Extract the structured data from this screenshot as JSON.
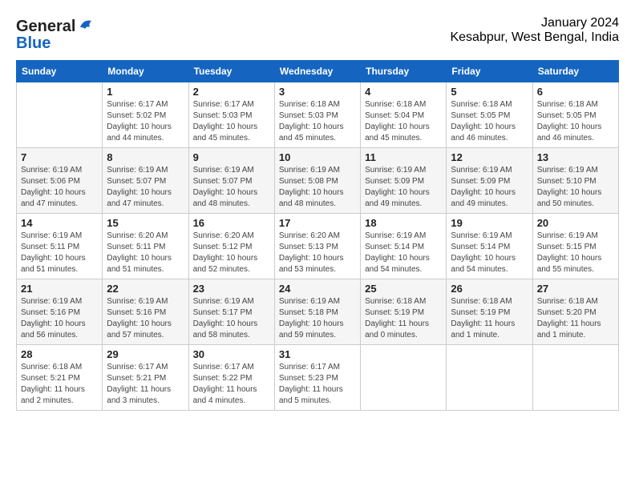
{
  "logo": {
    "general": "General",
    "blue": "Blue"
  },
  "header": {
    "month_year": "January 2024",
    "location": "Kesabpur, West Bengal, India"
  },
  "days_of_week": [
    "Sunday",
    "Monday",
    "Tuesday",
    "Wednesday",
    "Thursday",
    "Friday",
    "Saturday"
  ],
  "weeks": [
    [
      {
        "day": "",
        "info": ""
      },
      {
        "day": "1",
        "info": "Sunrise: 6:17 AM\nSunset: 5:02 PM\nDaylight: 10 hours\nand 44 minutes."
      },
      {
        "day": "2",
        "info": "Sunrise: 6:17 AM\nSunset: 5:03 PM\nDaylight: 10 hours\nand 45 minutes."
      },
      {
        "day": "3",
        "info": "Sunrise: 6:18 AM\nSunset: 5:03 PM\nDaylight: 10 hours\nand 45 minutes."
      },
      {
        "day": "4",
        "info": "Sunrise: 6:18 AM\nSunset: 5:04 PM\nDaylight: 10 hours\nand 45 minutes."
      },
      {
        "day": "5",
        "info": "Sunrise: 6:18 AM\nSunset: 5:05 PM\nDaylight: 10 hours\nand 46 minutes."
      },
      {
        "day": "6",
        "info": "Sunrise: 6:18 AM\nSunset: 5:05 PM\nDaylight: 10 hours\nand 46 minutes."
      }
    ],
    [
      {
        "day": "7",
        "info": "Sunrise: 6:19 AM\nSunset: 5:06 PM\nDaylight: 10 hours\nand 47 minutes."
      },
      {
        "day": "8",
        "info": "Sunrise: 6:19 AM\nSunset: 5:07 PM\nDaylight: 10 hours\nand 47 minutes."
      },
      {
        "day": "9",
        "info": "Sunrise: 6:19 AM\nSunset: 5:07 PM\nDaylight: 10 hours\nand 48 minutes."
      },
      {
        "day": "10",
        "info": "Sunrise: 6:19 AM\nSunset: 5:08 PM\nDaylight: 10 hours\nand 48 minutes."
      },
      {
        "day": "11",
        "info": "Sunrise: 6:19 AM\nSunset: 5:09 PM\nDaylight: 10 hours\nand 49 minutes."
      },
      {
        "day": "12",
        "info": "Sunrise: 6:19 AM\nSunset: 5:09 PM\nDaylight: 10 hours\nand 49 minutes."
      },
      {
        "day": "13",
        "info": "Sunrise: 6:19 AM\nSunset: 5:10 PM\nDaylight: 10 hours\nand 50 minutes."
      }
    ],
    [
      {
        "day": "14",
        "info": "Sunrise: 6:19 AM\nSunset: 5:11 PM\nDaylight: 10 hours\nand 51 minutes."
      },
      {
        "day": "15",
        "info": "Sunrise: 6:20 AM\nSunset: 5:11 PM\nDaylight: 10 hours\nand 51 minutes."
      },
      {
        "day": "16",
        "info": "Sunrise: 6:20 AM\nSunset: 5:12 PM\nDaylight: 10 hours\nand 52 minutes."
      },
      {
        "day": "17",
        "info": "Sunrise: 6:20 AM\nSunset: 5:13 PM\nDaylight: 10 hours\nand 53 minutes."
      },
      {
        "day": "18",
        "info": "Sunrise: 6:19 AM\nSunset: 5:14 PM\nDaylight: 10 hours\nand 54 minutes."
      },
      {
        "day": "19",
        "info": "Sunrise: 6:19 AM\nSunset: 5:14 PM\nDaylight: 10 hours\nand 54 minutes."
      },
      {
        "day": "20",
        "info": "Sunrise: 6:19 AM\nSunset: 5:15 PM\nDaylight: 10 hours\nand 55 minutes."
      }
    ],
    [
      {
        "day": "21",
        "info": "Sunrise: 6:19 AM\nSunset: 5:16 PM\nDaylight: 10 hours\nand 56 minutes."
      },
      {
        "day": "22",
        "info": "Sunrise: 6:19 AM\nSunset: 5:16 PM\nDaylight: 10 hours\nand 57 minutes."
      },
      {
        "day": "23",
        "info": "Sunrise: 6:19 AM\nSunset: 5:17 PM\nDaylight: 10 hours\nand 58 minutes."
      },
      {
        "day": "24",
        "info": "Sunrise: 6:19 AM\nSunset: 5:18 PM\nDaylight: 10 hours\nand 59 minutes."
      },
      {
        "day": "25",
        "info": "Sunrise: 6:18 AM\nSunset: 5:19 PM\nDaylight: 11 hours\nand 0 minutes."
      },
      {
        "day": "26",
        "info": "Sunrise: 6:18 AM\nSunset: 5:19 PM\nDaylight: 11 hours\nand 1 minute."
      },
      {
        "day": "27",
        "info": "Sunrise: 6:18 AM\nSunset: 5:20 PM\nDaylight: 11 hours\nand 1 minute."
      }
    ],
    [
      {
        "day": "28",
        "info": "Sunrise: 6:18 AM\nSunset: 5:21 PM\nDaylight: 11 hours\nand 2 minutes."
      },
      {
        "day": "29",
        "info": "Sunrise: 6:17 AM\nSunset: 5:21 PM\nDaylight: 11 hours\nand 3 minutes."
      },
      {
        "day": "30",
        "info": "Sunrise: 6:17 AM\nSunset: 5:22 PM\nDaylight: 11 hours\nand 4 minutes."
      },
      {
        "day": "31",
        "info": "Sunrise: 6:17 AM\nSunset: 5:23 PM\nDaylight: 11 hours\nand 5 minutes."
      },
      {
        "day": "",
        "info": ""
      },
      {
        "day": "",
        "info": ""
      },
      {
        "day": "",
        "info": ""
      }
    ]
  ]
}
